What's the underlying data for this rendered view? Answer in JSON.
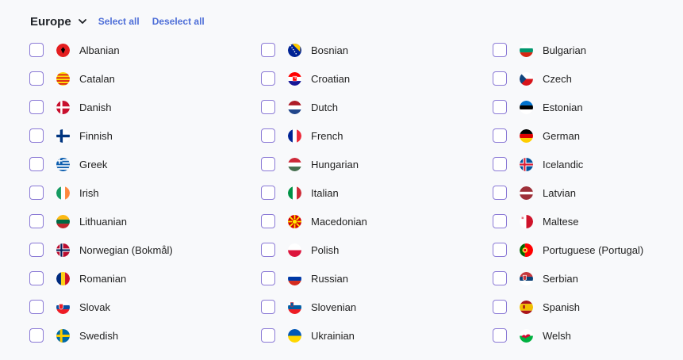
{
  "header": {
    "title": "Europe",
    "select_all": "Select all",
    "deselect_all": "Deselect all"
  },
  "languages": [
    {
      "label": "Albanian",
      "flag": "flag-albania"
    },
    {
      "label": "Catalan",
      "flag": "flag-catalonia"
    },
    {
      "label": "Danish",
      "flag": "flag-denmark"
    },
    {
      "label": "Finnish",
      "flag": "flag-finland"
    },
    {
      "label": "Greek",
      "flag": "flag-greece"
    },
    {
      "label": "Irish",
      "flag": "flag-ireland"
    },
    {
      "label": "Lithuanian",
      "flag": "flag-lithuania"
    },
    {
      "label": "Norwegian (Bokmål)",
      "flag": "flag-norway"
    },
    {
      "label": "Romanian",
      "flag": "flag-romania"
    },
    {
      "label": "Slovak",
      "flag": "flag-slovakia"
    },
    {
      "label": "Swedish",
      "flag": "flag-sweden"
    },
    {
      "label": "Bosnian",
      "flag": "flag-bosnia"
    },
    {
      "label": "Croatian",
      "flag": "flag-croatia"
    },
    {
      "label": "Dutch",
      "flag": "flag-netherlands"
    },
    {
      "label": "French",
      "flag": "flag-france"
    },
    {
      "label": "Hungarian",
      "flag": "flag-hungary"
    },
    {
      "label": "Italian",
      "flag": "flag-italy"
    },
    {
      "label": "Macedonian",
      "flag": "flag-north-macedonia"
    },
    {
      "label": "Polish",
      "flag": "flag-poland"
    },
    {
      "label": "Russian",
      "flag": "flag-russia"
    },
    {
      "label": "Slovenian",
      "flag": "flag-slovenia"
    },
    {
      "label": "Ukrainian",
      "flag": "flag-ukraine"
    },
    {
      "label": "Bulgarian",
      "flag": "flag-bulgaria"
    },
    {
      "label": "Czech",
      "flag": "flag-czechia"
    },
    {
      "label": "Estonian",
      "flag": "flag-estonia"
    },
    {
      "label": "German",
      "flag": "flag-germany"
    },
    {
      "label": "Icelandic",
      "flag": "flag-iceland"
    },
    {
      "label": "Latvian",
      "flag": "flag-latvia"
    },
    {
      "label": "Maltese",
      "flag": "flag-malta"
    },
    {
      "label": "Portuguese (Portugal)",
      "flag": "flag-portugal"
    },
    {
      "label": "Serbian",
      "flag": "flag-serbia"
    },
    {
      "label": "Spanish",
      "flag": "flag-spain"
    },
    {
      "label": "Welsh",
      "flag": "flag-wales"
    }
  ],
  "colors": {
    "accent": "#4f6fd8",
    "checkbox_border": "#8b7ad6",
    "background": "#f8f9fb"
  }
}
